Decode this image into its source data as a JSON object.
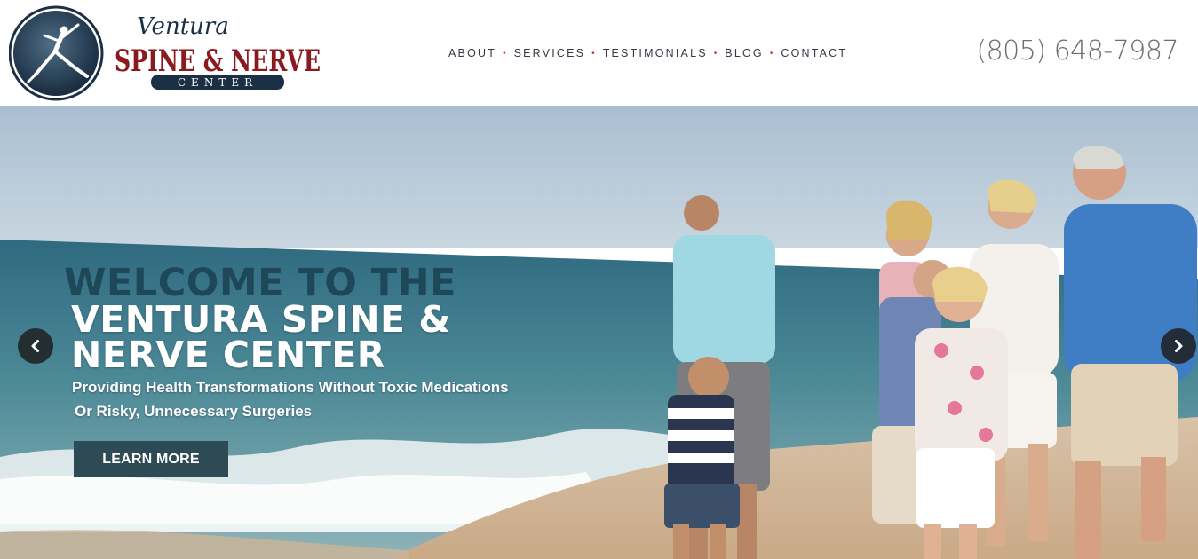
{
  "logo": {
    "script_word": "Ventura",
    "main_words": "SPINE & NERVE",
    "banner_word": "CENTER"
  },
  "nav": {
    "items": [
      {
        "label": "ABOUT"
      },
      {
        "label": "SERVICES"
      },
      {
        "label": "TESTIMONIALS"
      },
      {
        "label": "BLOG"
      },
      {
        "label": "CONTACT"
      }
    ],
    "separator": "•"
  },
  "phone": "(805) 648-7987",
  "hero": {
    "welcome": "WELCOME TO THE",
    "title_line1": "VENTURA SPINE &",
    "title_line2": "NERVE CENTER",
    "subtitle_line1": "Providing Health Transformations Without Toxic Medications",
    "subtitle_line2": "Or Risky, Unnecessary Surgeries",
    "cta_label": "LEARN MORE"
  },
  "colors": {
    "nav_separator": "#c9383d",
    "cta_bg": "#2e4a55",
    "welcome_text": "#1e4757",
    "logo_red": "#8b1a1f",
    "logo_navy": "#1b2f45"
  },
  "icons": {
    "prev": "chevron-left-icon",
    "next": "chevron-right-icon",
    "logo_emblem": "dancer-emblem-icon"
  }
}
